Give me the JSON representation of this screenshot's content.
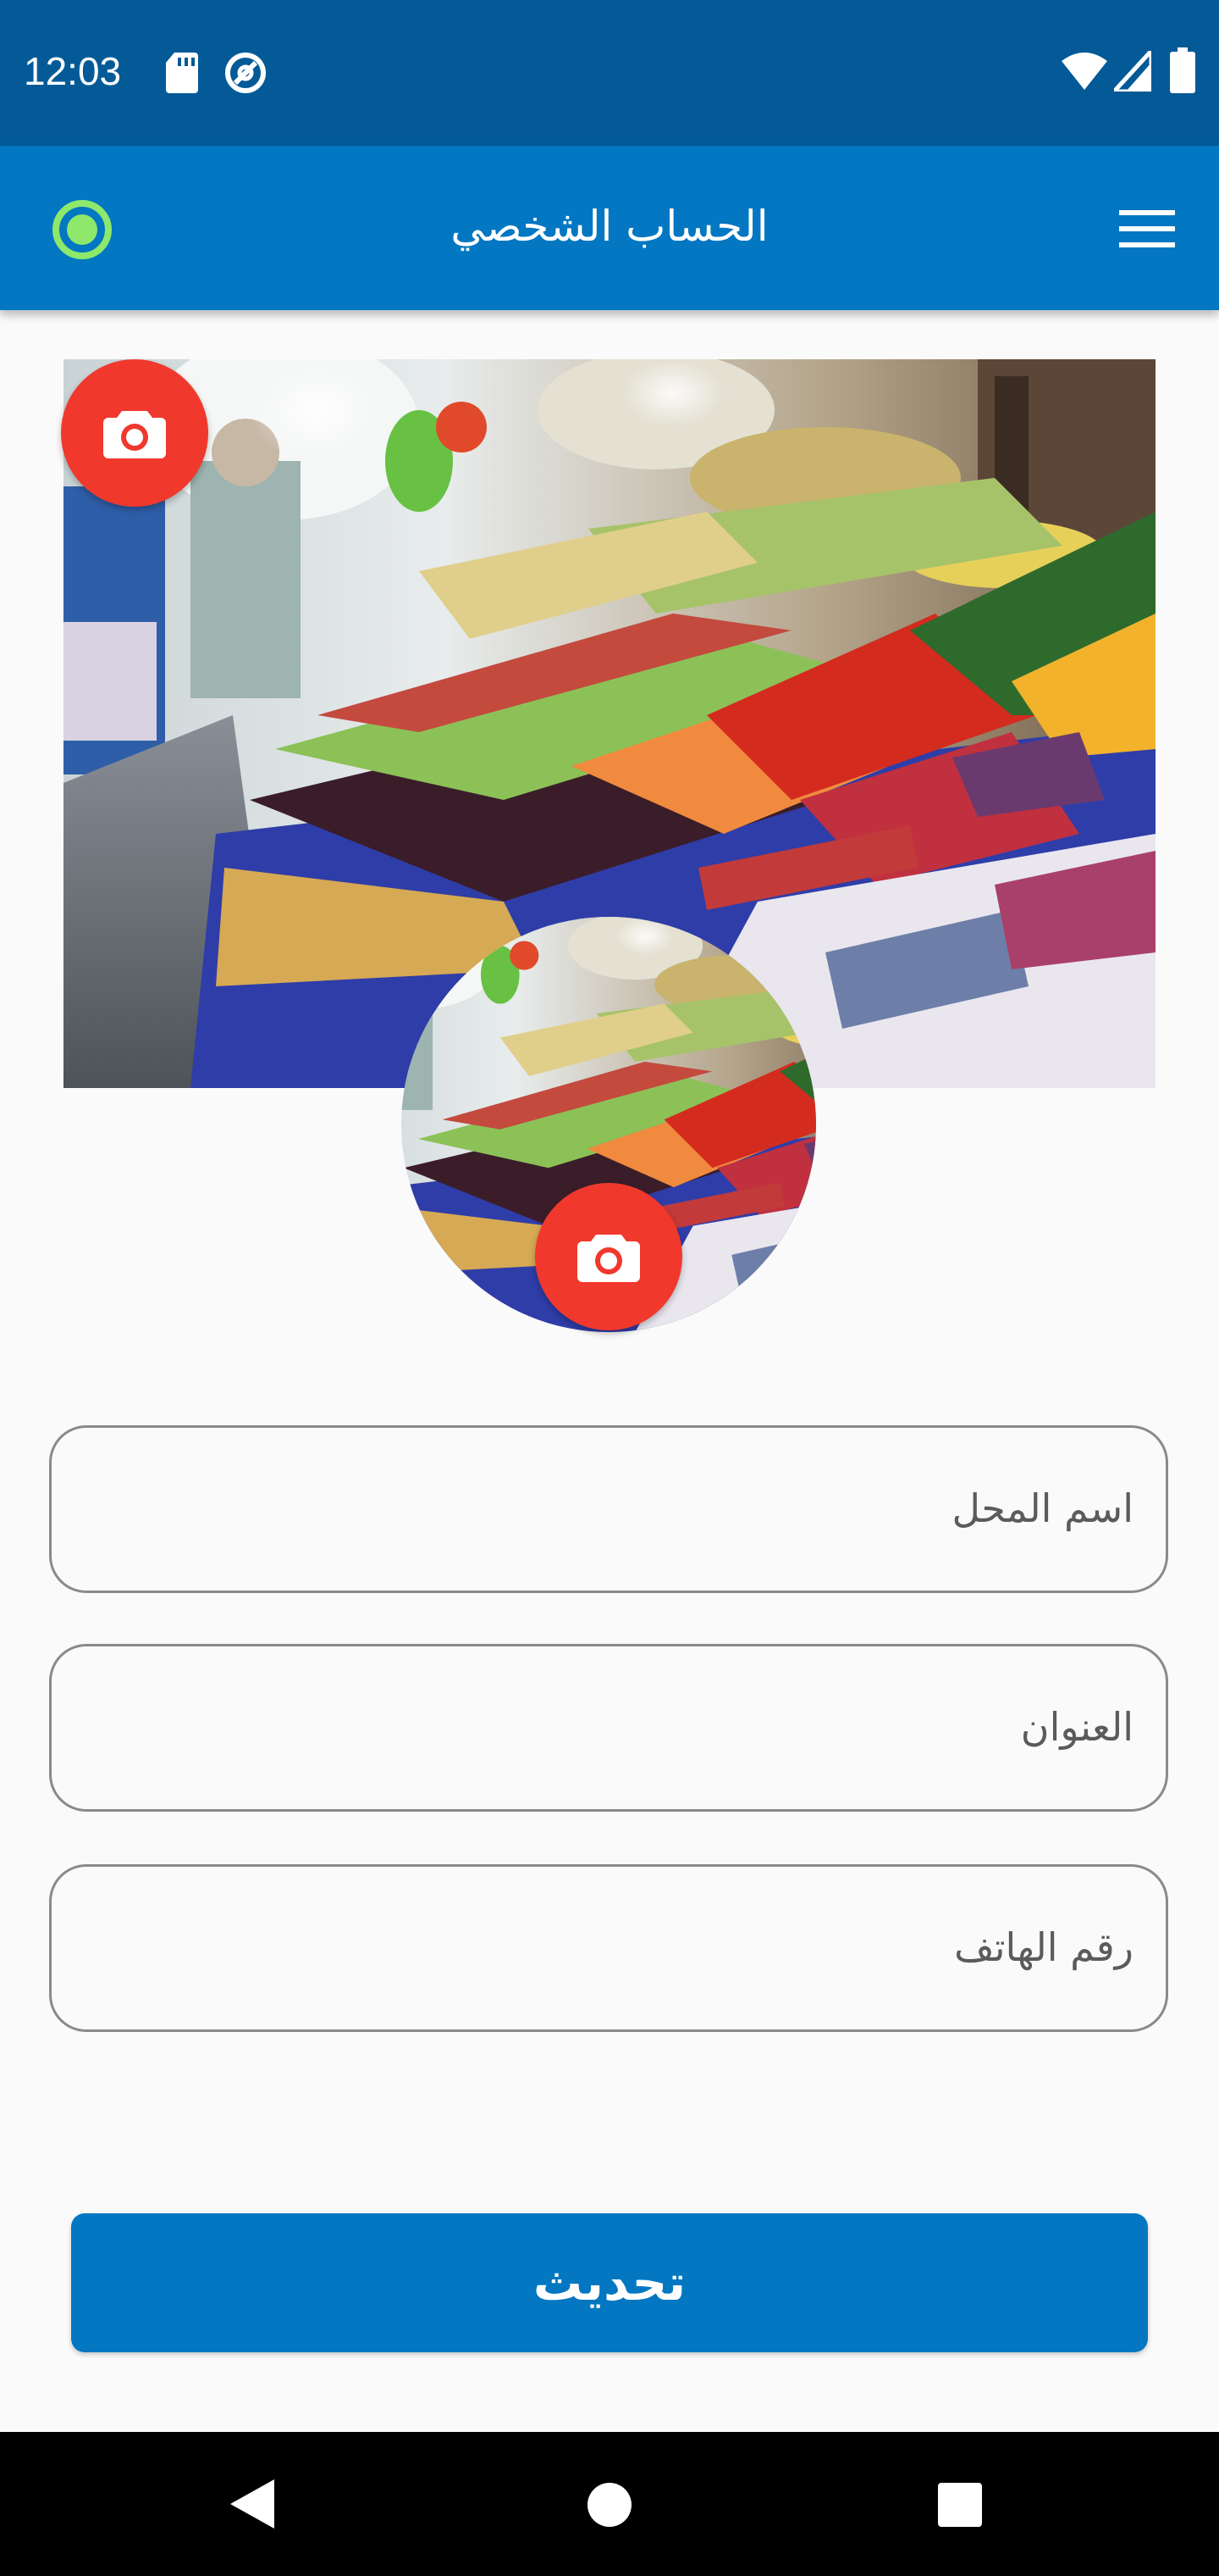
{
  "status_bar": {
    "time": "12:03",
    "icons": [
      "sd-card-icon",
      "data-saver-icon",
      "wifi-icon",
      "signal-icon",
      "battery-icon"
    ]
  },
  "app_bar": {
    "title": "الحساب الشخصي",
    "left_icon": "status-ring-icon",
    "right_icon": "menu-icon",
    "background": "#0377c2"
  },
  "profile": {
    "cover_image": "market-produce-photo",
    "avatar_image": "market-produce-photo",
    "camera_icon": "camera-icon",
    "camera_color": "#f0382d"
  },
  "form": {
    "fields": [
      {
        "label": "اسم المحل"
      },
      {
        "label": "العنوان"
      },
      {
        "label": "رقم الهاتف"
      }
    ],
    "submit_label": "تحديث"
  },
  "nav_bar": {
    "icons": [
      "back-icon",
      "home-icon",
      "recents-icon"
    ]
  }
}
